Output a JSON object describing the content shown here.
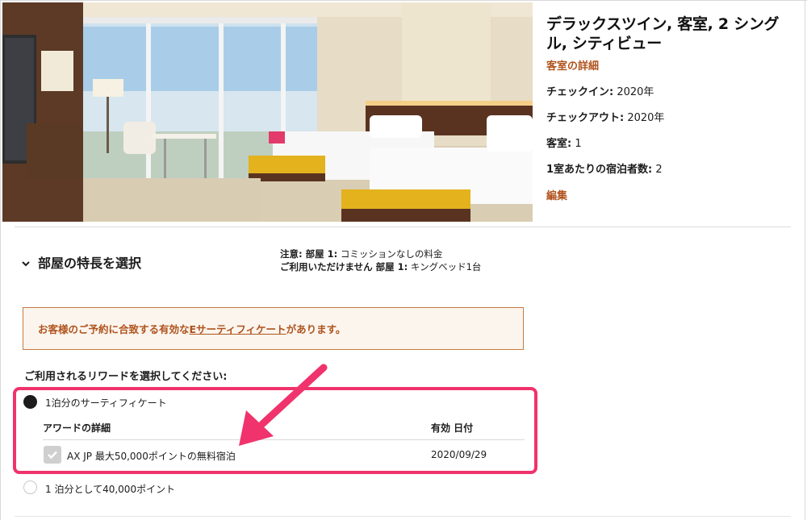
{
  "room": {
    "title": "デラックスツイン, 客室, 2 シングル, シティビュー",
    "details_link": "客室の詳細",
    "checkin_label": "チェックイン:",
    "checkin_value": "2020年",
    "checkout_label": "チェックアウト:",
    "checkout_value": "2020年",
    "rooms_label": "客室:",
    "rooms_value": "1",
    "guests_label": "1室あたりの宿泊者数:",
    "guests_value": "2",
    "edit_link": "編集"
  },
  "features": {
    "heading": "部屋の特長を選択",
    "note1_label": "注意: 部屋 1:",
    "note1_value": "コミッションなしの料金",
    "note2_label": "ご利用いただけません 部屋 1:",
    "note2_value": "キングベッド1台"
  },
  "notice": {
    "prefix": "お客様のご予約に合致する有効な",
    "link": "Eサーティフィケート",
    "suffix": "があります。"
  },
  "rewards": {
    "heading": "ご利用されるリワードを選択してください:",
    "option1": {
      "label": "1泊分のサーティフィケート",
      "selected": true,
      "col_award": "アワードの詳細",
      "col_valid": "有効 日付",
      "award_name": "AX JP 最大50,000ポイントの無料宿泊",
      "award_date": "2020/09/29",
      "checked": true
    },
    "option2": {
      "label": "1 泊分として40,000ポイント",
      "selected": false
    }
  },
  "colors": {
    "accent": "#b0531d",
    "highlight": "#f0336d",
    "notice_border": "#c47b45"
  },
  "icons": {
    "expand": "chevron-down-icon",
    "check": "check-icon",
    "annotation": "pink-arrow-annotation"
  }
}
